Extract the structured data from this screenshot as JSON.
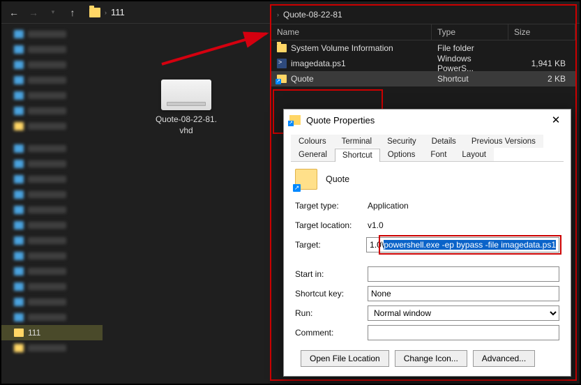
{
  "topbar": {
    "current_folder": "111"
  },
  "sidebar": {
    "selected_label": "111"
  },
  "main_file": {
    "name_line1": "Quote-08-22-81.",
    "name_line2": "vhd"
  },
  "rightpane": {
    "breadcrumb": "Quote-08-22-81",
    "columns": {
      "name": "Name",
      "type": "Type",
      "size": "Size"
    },
    "rows": [
      {
        "name": "System Volume Information",
        "type": "File folder",
        "size": ""
      },
      {
        "name": "imagedata.ps1",
        "type": "Windows PowerS...",
        "size": "1,941 KB"
      },
      {
        "name": "Quote",
        "type": "Shortcut",
        "size": "2 KB"
      }
    ]
  },
  "props": {
    "title": "Quote Properties",
    "tabs_row1": [
      "Colours",
      "Terminal",
      "Security",
      "Details",
      "Previous Versions"
    ],
    "tabs_row2": [
      "General",
      "Shortcut",
      "Options",
      "Font",
      "Layout"
    ],
    "active_tab": "Shortcut",
    "item_name": "Quote",
    "fields": {
      "target_type_label": "Target type:",
      "target_type_value": "Application",
      "target_loc_label": "Target location:",
      "target_loc_value": "v1.0",
      "target_label": "Target:",
      "target_prefix": "1.0\\",
      "target_value_highlight": "powershell.exe -ep bypass -file imagedata.ps1",
      "startin_label": "Start in:",
      "startin_value": "",
      "shortcutkey_label": "Shortcut key:",
      "shortcutkey_value": "None",
      "run_label": "Run:",
      "run_value": "Normal window",
      "comment_label": "Comment:",
      "comment_value": ""
    },
    "buttons": {
      "openloc": "Open File Location",
      "changeicon": "Change Icon...",
      "advanced": "Advanced..."
    }
  }
}
